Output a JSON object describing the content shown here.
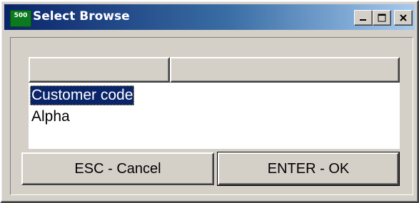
{
  "window": {
    "title": "Select Browse",
    "icon_label": "500",
    "controls": [
      "minimize-icon",
      "maximize-icon",
      "close-icon"
    ]
  },
  "list": {
    "column_headers": [
      "",
      ""
    ],
    "items": [
      {
        "label": "Customer code",
        "selected": true
      },
      {
        "label": "Alpha",
        "selected": false
      }
    ]
  },
  "buttons": {
    "cancel_label": "ESC - Cancel",
    "ok_label": "ENTER - OK"
  },
  "colors": {
    "selection": "#0a246a",
    "titlebar_start": "#0a246a",
    "titlebar_end": "#a6caf0",
    "face": "#d4d0c8"
  }
}
